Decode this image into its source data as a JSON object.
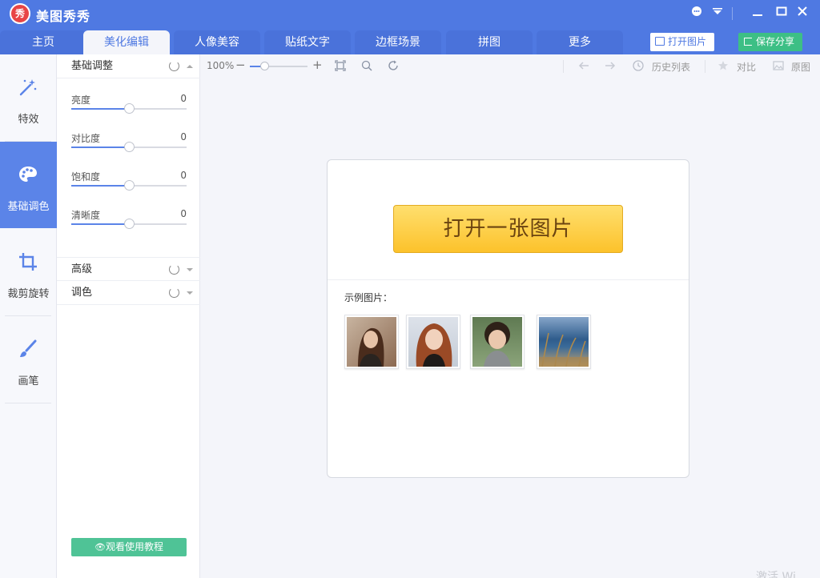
{
  "app": {
    "logo_char": "秀",
    "title": "美图秀秀"
  },
  "window_controls": {
    "chat": "chat-icon",
    "menu": "dropdown-icon",
    "minimize": "—",
    "maximize": "☐",
    "close": "✕"
  },
  "tabs": [
    {
      "label": "主页"
    },
    {
      "label": "美化编辑"
    },
    {
      "label": "人像美容"
    },
    {
      "label": "贴纸文字"
    },
    {
      "label": "边框场景"
    },
    {
      "label": "拼图"
    },
    {
      "label": "更多"
    }
  ],
  "active_tab": 1,
  "header_buttons": {
    "open": "打开图片",
    "save": "保存分享"
  },
  "left_nav": [
    {
      "label": "特效",
      "icon": "magic-wand-icon"
    },
    {
      "label": "基础调色",
      "icon": "palette-icon"
    },
    {
      "label": "裁剪旋转",
      "icon": "crop-icon"
    },
    {
      "label": "画笔",
      "icon": "brush-icon"
    }
  ],
  "panel": {
    "basic_title": "基础调整",
    "sliders": [
      {
        "label": "亮度",
        "value": "0",
        "level": 0.5
      },
      {
        "label": "对比度",
        "value": "0",
        "level": 0.5
      },
      {
        "label": "饱和度",
        "value": "0",
        "level": 0.5
      },
      {
        "label": "清晰度",
        "value": "0",
        "level": 0.5
      }
    ],
    "advanced_title": "高级",
    "color_title": "调色",
    "tutorial_button": "观看使用教程"
  },
  "toolbar": {
    "zoom": "100%",
    "zoom_minus": "−",
    "zoom_plus": "+",
    "history": "历史列表",
    "compare": "对比",
    "original": "原图"
  },
  "main": {
    "open_button": "打开一张图片",
    "sample_label": "示例图片：",
    "samples": [
      "sample-portrait-1",
      "sample-portrait-2",
      "sample-child",
      "sample-landscape"
    ]
  },
  "watermark": "激活 Wi",
  "colors": {
    "primary": "#4f79e2",
    "accent_green": "#3dbf85",
    "nav_active": "#5b84e8",
    "open_button": "#fcc22b"
  }
}
